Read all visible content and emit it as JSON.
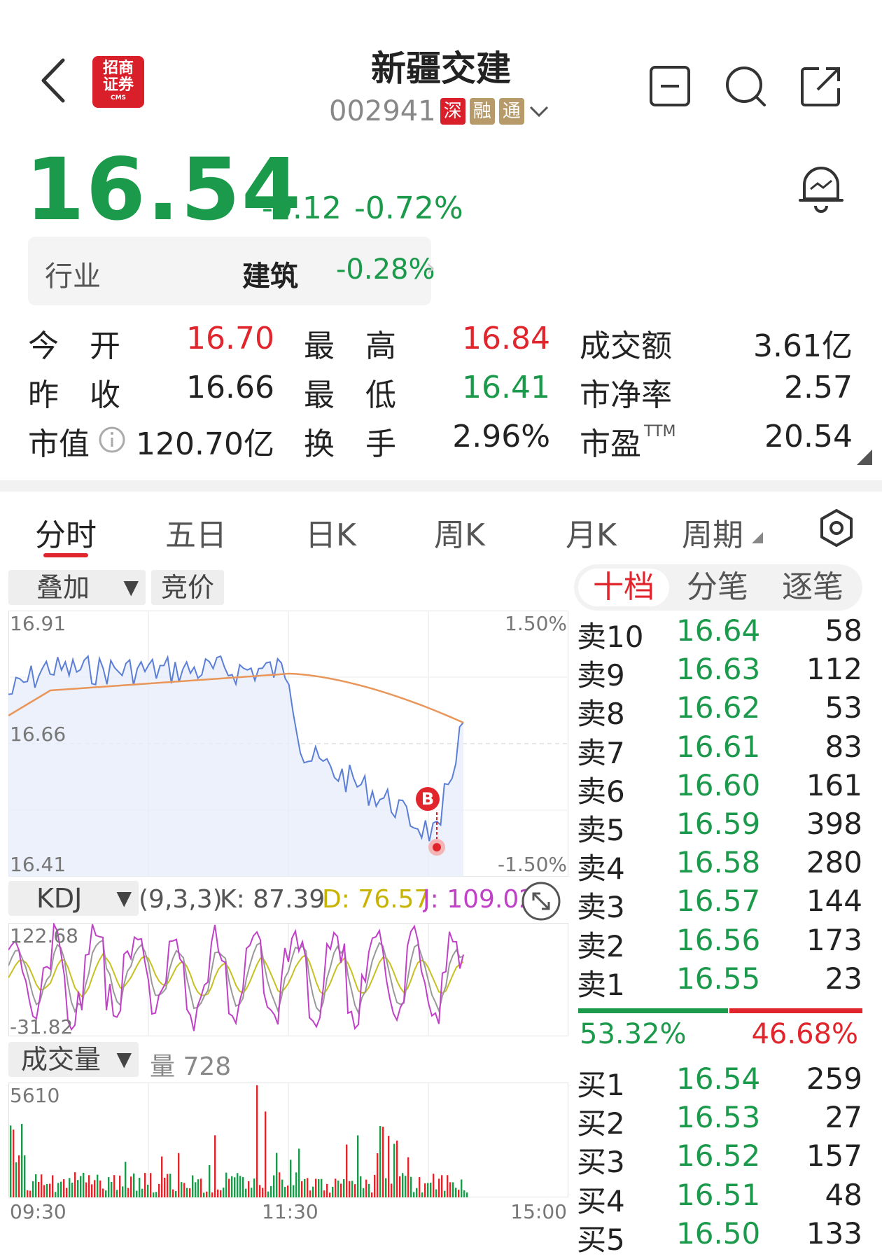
{
  "header": {
    "title": "新疆交建",
    "code": "002941",
    "badges": [
      "深",
      "融",
      "通"
    ],
    "logo_lines": [
      "招商",
      "证券",
      "CMS"
    ]
  },
  "quote": {
    "price": "16.54",
    "change": "-0.12",
    "change_pct": "-0.72%"
  },
  "industry": {
    "label": "行业",
    "name": "建筑",
    "change_pct": "-0.28%"
  },
  "stats": {
    "open_label": "今　开",
    "open": "16.70",
    "high_label": "最　高",
    "high": "16.84",
    "amount_label": "成交额",
    "amount": "3.61亿",
    "prev_close_label": "昨　收",
    "prev_close": "16.66",
    "low_label": "最　低",
    "low": "16.41",
    "pb_label": "市净率",
    "pb": "2.57",
    "mcap_label": "市值",
    "mcap": "120.70亿",
    "turnover_label": "换　手",
    "turnover": "2.96%",
    "pe_label": "市盈",
    "pe_sup": "TTM",
    "pe": "20.54"
  },
  "tabs": [
    "分时",
    "五日",
    "日K",
    "周K",
    "月K",
    "周期"
  ],
  "chart": {
    "overlay_btn": "叠加",
    "auction_btn": "竞价",
    "price_top": "16.91",
    "price_mid": "16.66",
    "price_bottom": "16.41",
    "pct_top": "1.50%",
    "pct_bottom": "-1.50%",
    "b_marker": "B",
    "kdj_btn": "KDJ",
    "kdj_params": "(9,3,3)",
    "kdj_k": "K: 87.39",
    "kdj_d": "D: 76.57",
    "kdj_j": "J: 109.02",
    "kdj_top": "122.68",
    "kdj_bottom": "-31.82",
    "vol_btn": "成交量",
    "vol_label": "量 728",
    "vol_top": "5610",
    "time_start": "09:30",
    "time_mid": "11:30",
    "time_end": "15:00",
    "colors": {
      "price_line": "#5b7fd6",
      "avg_line": "#e8965a",
      "k": "#999999",
      "d": "#c8c020",
      "j": "#c040c8",
      "up": "#e0262c",
      "down": "#1a9a4a"
    }
  },
  "orderbook": {
    "tabs": [
      "十档",
      "分笔",
      "逐笔"
    ],
    "asks": [
      {
        "label": "卖10",
        "price": "16.64",
        "vol": "58"
      },
      {
        "label": "卖9",
        "price": "16.63",
        "vol": "112"
      },
      {
        "label": "卖8",
        "price": "16.62",
        "vol": "53"
      },
      {
        "label": "卖7",
        "price": "16.61",
        "vol": "83"
      },
      {
        "label": "卖6",
        "price": "16.60",
        "vol": "161"
      },
      {
        "label": "卖5",
        "price": "16.59",
        "vol": "398"
      },
      {
        "label": "卖4",
        "price": "16.58",
        "vol": "280"
      },
      {
        "label": "卖3",
        "price": "16.57",
        "vol": "144"
      },
      {
        "label": "卖2",
        "price": "16.56",
        "vol": "173"
      },
      {
        "label": "卖1",
        "price": "16.55",
        "vol": "23"
      }
    ],
    "buy_ratio": "53.32%",
    "sell_ratio": "46.68%",
    "bids": [
      {
        "label": "买1",
        "price": "16.54",
        "vol": "259"
      },
      {
        "label": "买2",
        "price": "16.53",
        "vol": "27"
      },
      {
        "label": "买3",
        "price": "16.52",
        "vol": "157"
      },
      {
        "label": "买4",
        "price": "16.51",
        "vol": "48"
      },
      {
        "label": "买5",
        "price": "16.50",
        "vol": "133"
      }
    ]
  }
}
